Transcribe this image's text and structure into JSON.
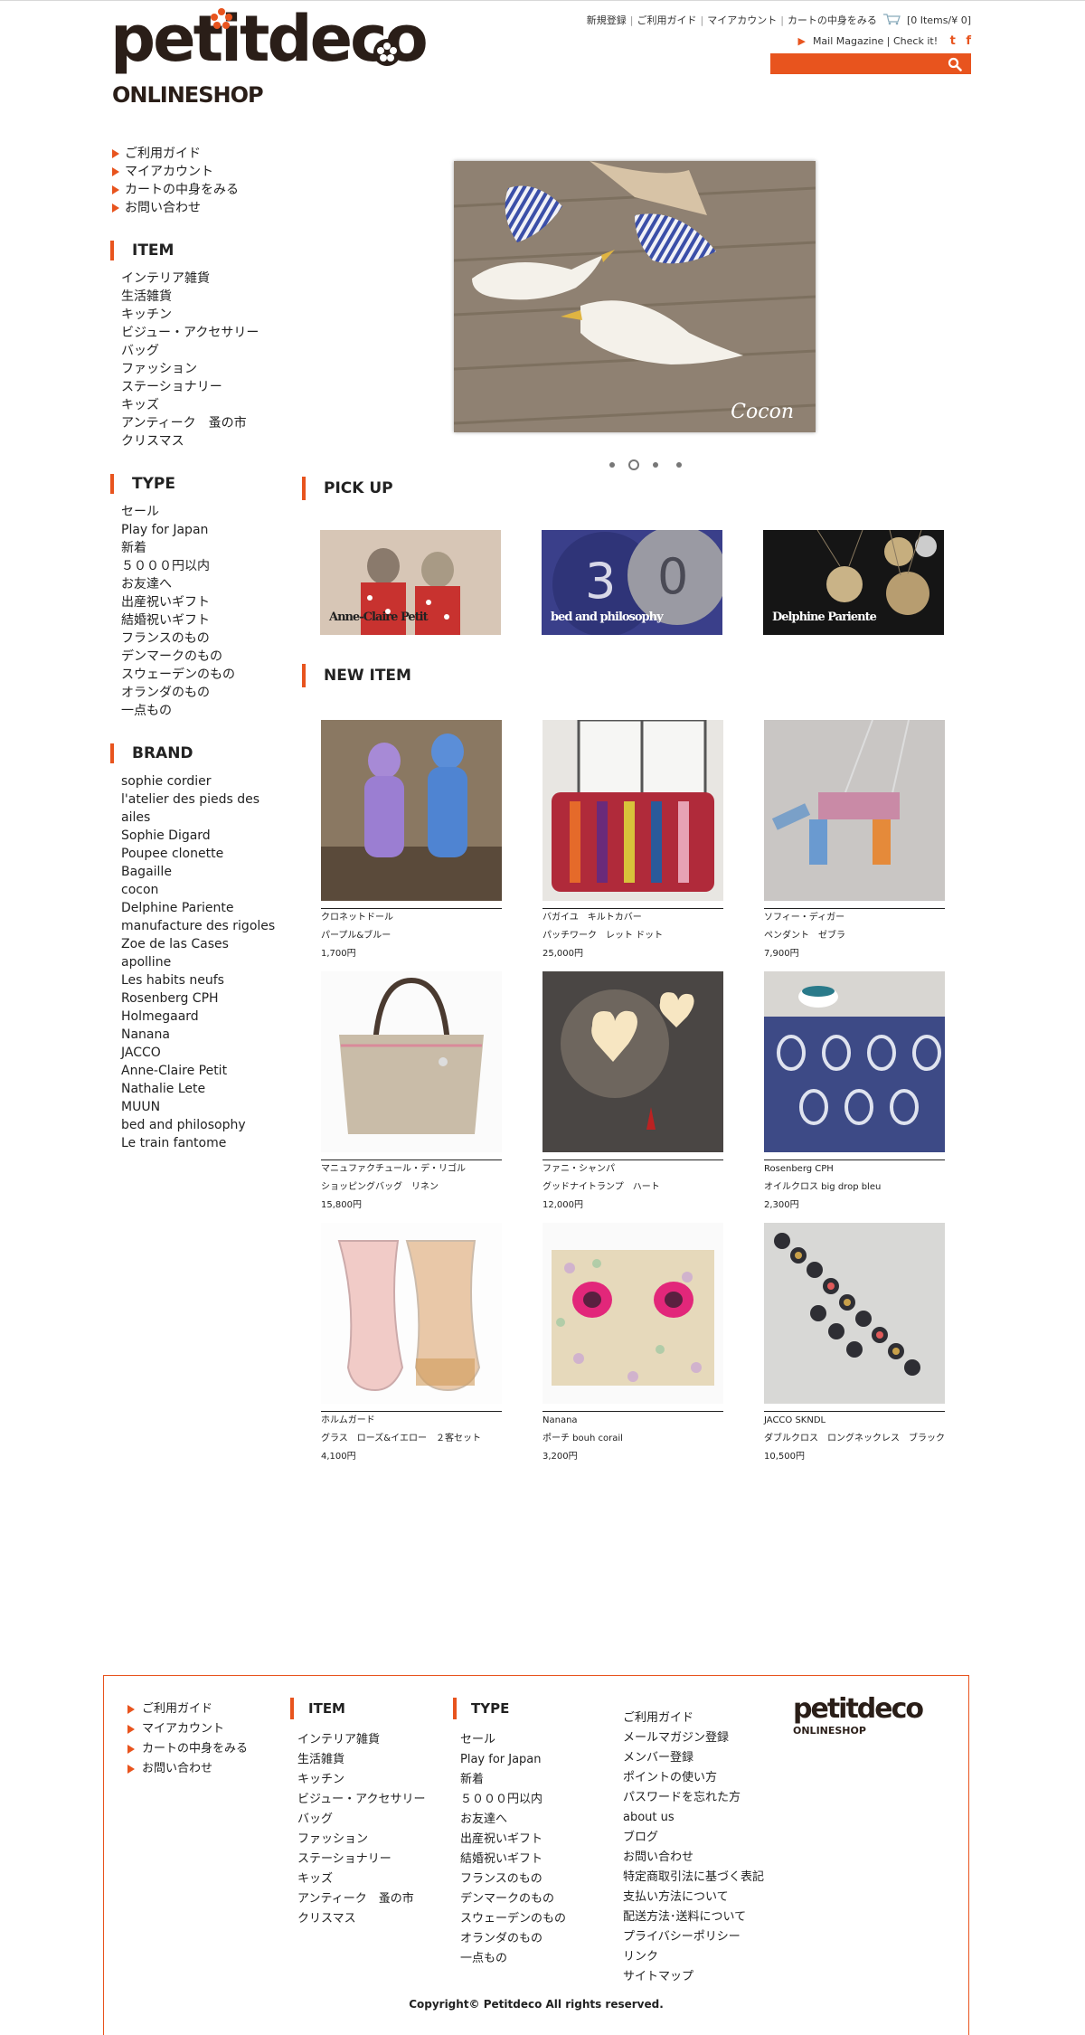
{
  "header": {
    "logo_text": "petitdeco",
    "logo_sub": "ONLINESHOP",
    "top_links": [
      "新規登録",
      "ご利用ガイド",
      "マイアカウント",
      "カートの中身をみる"
    ],
    "cart_status": "[0 Items/¥ 0]",
    "mail_magazine": "Mail Magazine | Check it!",
    "social": [
      "t",
      "f"
    ],
    "accent": "#e8541e"
  },
  "sidebar": {
    "guide": [
      "ご利用ガイド",
      "マイアカウント",
      "カートの中身をみる",
      "お問い合わせ"
    ],
    "item": {
      "title": "ITEM",
      "links": [
        "インテリア雑貨",
        "生活雑貨",
        "キッチン",
        "ビジュー・アクセサリー",
        "バッグ",
        "ファッション",
        "ステーショナリー",
        "キッズ",
        "アンティーク　蚤の市",
        "クリスマス"
      ]
    },
    "type": {
      "title": "TYPE",
      "links": [
        "セール",
        "Play for Japan",
        "新着",
        "５０００円以内",
        "お友達へ",
        "出産祝いギフト",
        "結婚祝いギフト",
        "フランスのもの",
        "デンマークのもの",
        "スウェーデンのもの",
        "オランダのもの",
        "一点もの"
      ]
    },
    "brand": {
      "title": "BRAND",
      "links": [
        "sophie cordier",
        "l'atelier des pieds des",
        "ailes",
        "Sophie Digard",
        "Poupee clonette",
        "Bagaille",
        "cocon",
        "Delphine Pariente",
        "manufacture des rigoles",
        "Zoe de las Cases",
        "apolline",
        "Les habits neufs",
        "Rosenberg CPH",
        "Holmegaard",
        "Nanana",
        "JACCO",
        "Anne-Claire Petit",
        "Nathalie Lete",
        "MUUN",
        "bed and philosophy",
        "Le train fantome"
      ]
    }
  },
  "slideshow": {
    "caption": "Cocon"
  },
  "pickup": {
    "title": "PICK UP",
    "items": [
      {
        "caption": "Anne-Claire Petit"
      },
      {
        "caption": "bed and philosophy"
      },
      {
        "caption": "Delphine Pariente"
      }
    ]
  },
  "new_item": {
    "title": "NEW ITEM",
    "items": [
      {
        "brand": "クロネットドール",
        "name": "パープル&ブルー",
        "price": "1,700円"
      },
      {
        "brand": "バガイユ　キルトカバー",
        "name": "パッチワーク　レット ドット",
        "price": "25,000円"
      },
      {
        "brand": "ソフィー・ディガー",
        "name": "ペンダント　ゼブラ",
        "price": "7,900円"
      },
      {
        "brand": "マニュファクチュール・デ・リゴル",
        "name": "ショッピングバッグ　リネン",
        "price": "15,800円"
      },
      {
        "brand": "ファニ・シャンパ",
        "name": "グッドナイトランプ　ハート",
        "price": "12,000円"
      },
      {
        "brand": "Rosenberg CPH",
        "name": "オイルクロス big drop bleu",
        "price": "2,300円"
      },
      {
        "brand": "ホルムガード",
        "name": "グラス　ローズ&イエロー　２客セット",
        "price": "4,100円"
      },
      {
        "brand": "Nanana",
        "name": "ポーチ bouh corail",
        "price": "3,200円"
      },
      {
        "brand": "JACCO SKNDL",
        "name": "ダブルクロス　ロングネックレス　ブラック",
        "price": "10,500円"
      }
    ]
  },
  "footer": {
    "guide": [
      "ご利用ガイド",
      "マイアカウント",
      "カートの中身をみる",
      "お問い合わせ"
    ],
    "item_title": "ITEM",
    "item_links": [
      "インテリア雑貨",
      "生活雑貨",
      "キッチン",
      "ビジュー・アクセサリー",
      "バッグ",
      "ファッション",
      "ステーショナリー",
      "キッズ",
      "アンティーク　蚤の市",
      "クリスマス"
    ],
    "type_title": "TYPE",
    "type_links": [
      "セール",
      "Play for Japan",
      "新着",
      "５０００円以内",
      "お友達へ",
      "出産祝いギフト",
      "結婚祝いギフト",
      "フランスのもの",
      "デンマークのもの",
      "スウェーデンのもの",
      "オランダのもの",
      "一点もの"
    ],
    "info_links": [
      "ご利用ガイド",
      "メールマガジン登録",
      "メンバー登録",
      "ポイントの使い方",
      "パスワードを忘れた方",
      "about us",
      "ブログ",
      "お問い合わせ",
      "特定商取引法に基づく表記",
      "支払い方法について",
      "配送方法･送料について",
      "プライバシーポリシー",
      "リンク",
      "サイトマップ"
    ],
    "logo_text": "petitdeco",
    "logo_sub": "ONLINESHOP",
    "copyright": "Copyright© Petitdeco All rights reserved."
  }
}
